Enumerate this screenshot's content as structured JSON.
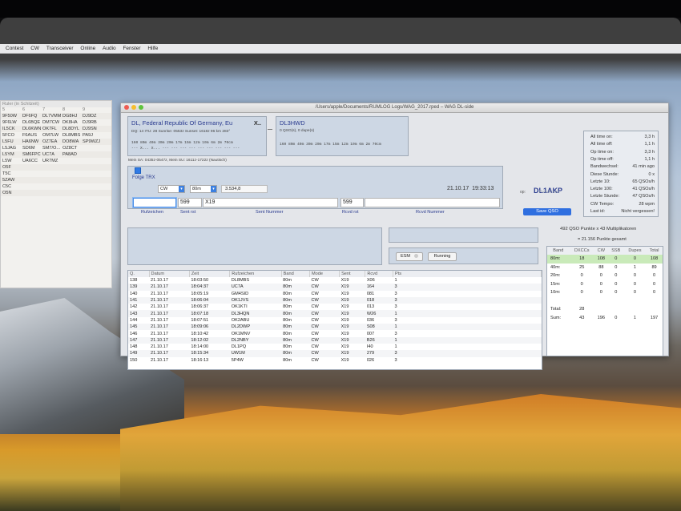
{
  "menubar": [
    "Contest",
    "CW",
    "Transceiver",
    "Online",
    "Audio",
    "Fenster",
    "Hilfe"
  ],
  "left_panel": {
    "title": "Ruler (in Schitzeit)",
    "header": [
      "5",
      "6",
      "7",
      "8",
      "9"
    ],
    "rows": [
      [
        "9F50W",
        "DF6FQ",
        "DL7VMM",
        "DG8HJ",
        "DJ9DZ"
      ],
      [
        "9F6LW",
        "DL6BQE",
        "DM7CW",
        "DK8HA",
        "DJ9RB"
      ],
      [
        "IL5CK",
        "DL6KWN",
        "OK7FL",
        "DL8DYL",
        "DJ9SN"
      ],
      [
        "5FCO",
        "F6AUS",
        "OM7LW",
        "DL8MBS",
        "PA9J"
      ],
      [
        "L5FU",
        "HA6NW",
        "OZ7EA",
        "DO8WA",
        "SP9WZJ"
      ],
      [
        "L5JAG",
        "SD6M",
        "SM7/O...",
        "OZ8CT",
        ""
      ],
      [
        "L5YM",
        "SM6FPC",
        "UC7A",
        "PA8AD",
        ""
      ],
      [
        "L5W",
        "UA6CC",
        "UR7MZ",
        "",
        ""
      ],
      [
        "O5F",
        "",
        "",
        "",
        ""
      ],
      [
        "T5C",
        "",
        "",
        "",
        ""
      ],
      [
        "5ZAW",
        "",
        "",
        "",
        ""
      ],
      [
        "C5C",
        "",
        "",
        "",
        ""
      ],
      [
        "O5N",
        "",
        "",
        "",
        ""
      ]
    ]
  },
  "window": {
    "title": "/Users/apple/Documents/RUMLOG Logs/WAG_2017.rped – WAG DL-side"
  },
  "dxcc": {
    "name": "DL, Federal Republic Of Germany, Eu",
    "marker": "X..",
    "info": "DQ: 14 ITU: 28 Sunrise: 0553z Sunset: 1618z 96 km 283°",
    "bands": "160 80m 40m 30m 20m 17m 15m 12m 10m  6m  2m 70cm",
    "marks": "--- X... X... --- --- --- --- --- --- --- --- ---"
  },
  "call_box": {
    "call": "DL3HWD",
    "info": "0 QSO(s), 0 dupe(s)",
    "bands": "160 80m 40m 30m 20m 17m 15m 12m 10m  6m  2m 70cm"
  },
  "sun_line": "Mein SA: 0435z-0547z, Mein SU: 1611z-1722z (Nautisch)",
  "entry": {
    "follow_trx": "Folge TRX",
    "mode": "CW",
    "band": "80m",
    "freq": "3.534,8",
    "date": "21.10.17",
    "time": "19:33:13",
    "sent_rst": "599",
    "sent_nr": "X19",
    "rcvd_rst": "599",
    "label_call": "Rufzeichen",
    "label_sent_rst": "Sent rst",
    "label_sent_nr": "Sent Nummer",
    "label_rcvd_rst": "Rcvd rst",
    "label_rcvd_nr": "Rcvd Nummer"
  },
  "operator": {
    "call": "DL1AKP",
    "op_label": "op:",
    "call_label": "Rufzeichen",
    "save": "Save QSO"
  },
  "stats": [
    [
      "All time on:",
      "3,3 h"
    ],
    [
      "All time off:",
      "1,1 h"
    ],
    [
      "Op time on:",
      "3,3 h"
    ],
    [
      "Op time off:",
      "1,1 h"
    ],
    [
      "Bandwechsel:",
      "41 min ago"
    ],
    [
      "Diese Stunde:",
      "0 x"
    ],
    [
      "Letzte 10:",
      "65 QSOs/h"
    ],
    [
      "Letzte 100:",
      "41 QSOs/h"
    ],
    [
      "Letzte Stunde:",
      "47 QSOs/h"
    ],
    [
      "CW Tempo:",
      "28 wpm"
    ],
    [
      "Last id:",
      "Nicht vergessen!"
    ]
  ],
  "cw": {
    "esm": "ESM",
    "running": "Running"
  },
  "summary": {
    "line1": "492 QSO Punkte x 43 Multiplikatoren",
    "line2": "= 21.156 Punkte gesamt"
  },
  "log": {
    "headers": [
      "Q.",
      "Datum",
      "Zeit",
      "Rufzeichen",
      "Band",
      "Mode",
      "Sent",
      "Rcvd",
      "Pts"
    ],
    "rows": [
      [
        "138",
        "21.10.17",
        "18:03:50",
        "DL8MBS",
        "80m",
        "CW",
        "X19",
        "X06",
        "1"
      ],
      [
        "139",
        "21.10.17",
        "18:04:37",
        "UC7A",
        "80m",
        "CW",
        "X19",
        "164",
        "3"
      ],
      [
        "140",
        "21.10.17",
        "18:05:19",
        "GM4SID",
        "80m",
        "CW",
        "X19",
        "081",
        "3"
      ],
      [
        "141",
        "21.10.17",
        "18:06:04",
        "OK1JVS",
        "80m",
        "CW",
        "X19",
        "018",
        "3"
      ],
      [
        "142",
        "21.10.17",
        "18:06:37",
        "OK1KTI",
        "80m",
        "CW",
        "X19",
        "013",
        "3"
      ],
      [
        "143",
        "21.10.17",
        "18:07:18",
        "DL3HQN",
        "80m",
        "CW",
        "X19",
        "W26",
        "1"
      ],
      [
        "144",
        "21.10.17",
        "18:07:51",
        "OK2ABU",
        "80m",
        "CW",
        "X19",
        "036",
        "3"
      ],
      [
        "145",
        "21.10.17",
        "18:09:06",
        "DL2DWP",
        "80m",
        "CW",
        "X19",
        "S08",
        "1"
      ],
      [
        "146",
        "21.10.17",
        "18:10:42",
        "OK1MNV",
        "80m",
        "CW",
        "X19",
        "007",
        "3"
      ],
      [
        "147",
        "21.10.17",
        "18:12:02",
        "DL2NBY",
        "80m",
        "CW",
        "X19",
        "B26",
        "1"
      ],
      [
        "148",
        "21.10.17",
        "18:14:00",
        "DL1PQ",
        "80m",
        "CW",
        "X19",
        "I40",
        "1"
      ],
      [
        "149",
        "21.10.17",
        "18:15:34",
        "UW1M",
        "80m",
        "CW",
        "X19",
        "279",
        "3"
      ],
      [
        "150",
        "21.10.17",
        "18:16:13",
        "5P4W",
        "80m",
        "CW",
        "X19",
        "026",
        "3"
      ]
    ]
  },
  "band_table": {
    "headers": [
      "Band",
      "DXCCs",
      "CW",
      "SSB",
      "Dupes",
      "Total"
    ],
    "rows": [
      [
        "80m:",
        "18",
        "108",
        "0",
        "0",
        "108"
      ],
      [
        "40m:",
        "25",
        "88",
        "0",
        "1",
        "89"
      ],
      [
        "20m:",
        "0",
        "0",
        "0",
        "0",
        "0"
      ],
      [
        "15m:",
        "0",
        "0",
        "0",
        "0",
        "0"
      ],
      [
        "10m:",
        "0",
        "0",
        "0",
        "0",
        "0"
      ],
      [
        "",
        "",
        "",
        "",
        "",
        ""
      ],
      [
        "Total:",
        "28",
        "",
        "",
        "",
        ""
      ],
      [
        "Sum:",
        "43",
        "196",
        "0",
        "1",
        "197"
      ]
    ]
  }
}
